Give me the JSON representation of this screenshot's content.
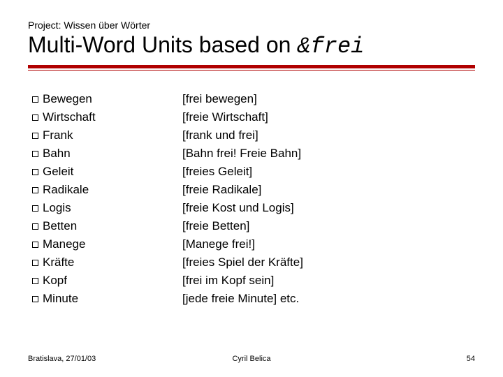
{
  "header": {
    "project": "Project: Wissen über Wörter",
    "title_prefix": "Multi-Word Units based on ",
    "title_code": "&frei"
  },
  "rows": [
    {
      "term": "Bewegen",
      "unit": "[frei bewegen]"
    },
    {
      "term": "Wirtschaft",
      "unit": "[freie Wirtschaft]"
    },
    {
      "term": "Frank",
      "unit": "[frank und frei]"
    },
    {
      "term": "Bahn",
      "unit": "[Bahn frei! Freie Bahn]"
    },
    {
      "term": "Geleit",
      "unit": "[freies Geleit]"
    },
    {
      "term": "Radikale",
      "unit": "[freie Radikale]"
    },
    {
      "term": "Logis",
      "unit": "[freie Kost und Logis]"
    },
    {
      "term": "Betten",
      "unit": "[freie Betten]"
    },
    {
      "term": "Manege",
      "unit": "[Manege frei!]"
    },
    {
      "term": "Kräfte",
      "unit": "[freies Spiel der Kräfte]"
    },
    {
      "term": "Kopf",
      "unit": "[frei im Kopf sein]"
    },
    {
      "term": "Minute",
      "unit": "[jede freie Minute] etc."
    }
  ],
  "footer": {
    "left": "Bratislava, 27/01/03",
    "center": "Cyril Belica",
    "right": "54"
  },
  "colors": {
    "accent": "#b00000"
  }
}
